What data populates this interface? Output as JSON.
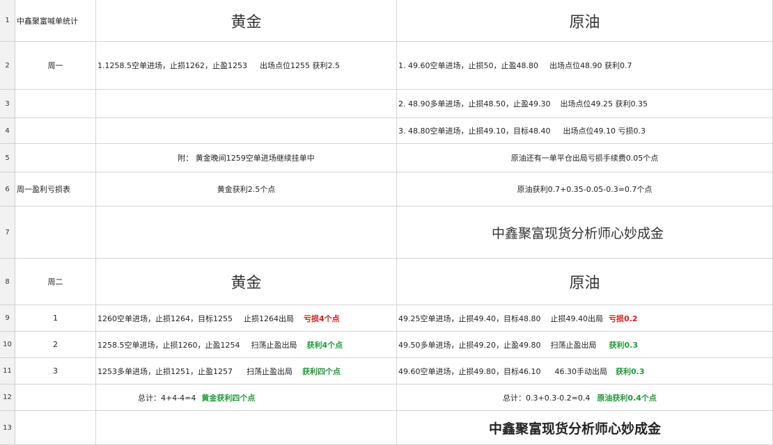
{
  "rows": [
    "1",
    "2",
    "3",
    "4",
    "5",
    "6",
    "7",
    "8",
    "9",
    "10",
    "11",
    "12",
    "13"
  ],
  "r1": {
    "label": "中鑫聚富喊单统计",
    "gold": "黄金",
    "oil": "原油"
  },
  "r2": {
    "label": "周一",
    "gold": "1.1258.5空单进场，止损1262，止盈1253",
    "gold_exit": "出场点位1255 获利2.5",
    "oil": "1.  49.60空单进场，止损50，止盈48.80",
    "oil_exit": "出场点位48.90   获利0.7"
  },
  "r3": {
    "oil": "2.  48.90多单进场，止损48.50，止盈49.30",
    "oil_exit": "出场点位49.25   获利0.35"
  },
  "r4": {
    "oil": "3.  48.80空单进场，止损49.10，目标48.40",
    "oil_exit": "出场点位49.10   亏损0.3"
  },
  "r5": {
    "gold": "附：  黄金晚间1259空单进场继续挂单中",
    "oil": "原油还有一单平仓出局亏损手续费0.05个点"
  },
  "r6": {
    "label": "周一盈利亏损表",
    "gold": "黄金获利2.5个点",
    "oil": "原油获利0.7+0.35-0.05-0.3=0.7个点"
  },
  "r7": {
    "oil": "中鑫聚富现货分析师心妙成金"
  },
  "r8": {
    "label": "周二",
    "gold": "黄金",
    "oil": "原油"
  },
  "r9": {
    "label": "1",
    "gold": "1260空单进场，止损1264，目标1255",
    "gold_exit": "止损1264出局",
    "gold_result": "亏损4个点",
    "oil": "49.25空单进场，止损49.40，目标48.80",
    "oil_exit": "止损49.40出局",
    "oil_result": "亏损0.2"
  },
  "r10": {
    "label": "2",
    "gold": "1258.5空单进场，止损1260，止盈1254",
    "gold_exit": "扫荡止盈出局",
    "gold_result": "获利4个点",
    "oil": "49.50多单进场，止损49.20，止盈49.80",
    "oil_exit": "扫荡止盈出局",
    "oil_result": "获利0.3"
  },
  "r11": {
    "label": "3",
    "gold": "1253多单进场，止损1251，止盈1257",
    "gold_exit": "扫荡止盈出局",
    "gold_result": "获利四个点",
    "oil": "49.60空单进场，止损49.80，目标46.10",
    "oil_exit": "46.30手动出局",
    "oil_result": "获利0.3"
  },
  "r12": {
    "gold": "总计：4+4-4=4",
    "gold_result": "黄金获利四个点",
    "oil": "总计：0.3+0.3-0.2=0.4",
    "oil_result": "原油获利0.4个点"
  },
  "r13": {
    "oil": "中鑫聚富现货分析师心妙成金"
  },
  "colors": {
    "loss": "#d01e1e",
    "profit": "#1f9a3a"
  }
}
